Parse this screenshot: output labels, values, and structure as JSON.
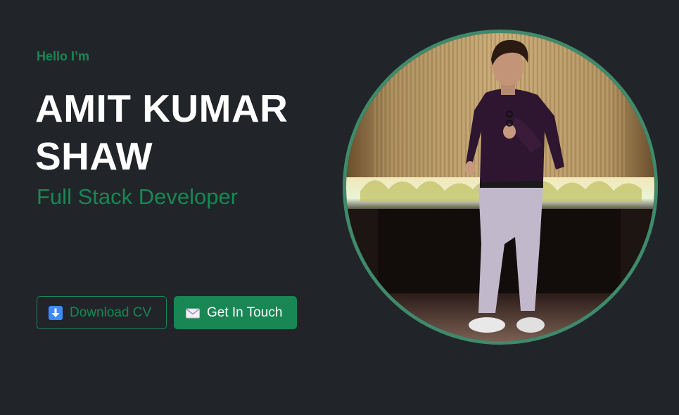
{
  "hero": {
    "greeting": "Hello I’m",
    "name": "AMIT KUMAR SHAW",
    "role": "Full Stack Developer"
  },
  "buttons": {
    "download_cv": {
      "label": "Download CV",
      "icon": "download-arrow-icon"
    },
    "get_in_touch": {
      "label": "Get In Touch",
      "icon": "envelope-icon"
    }
  },
  "colors": {
    "background": "#212529",
    "accent": "#198754",
    "ring": "#3f8a6a",
    "heading": "#ffffff"
  },
  "profile_photo": {
    "shape": "circle"
  }
}
